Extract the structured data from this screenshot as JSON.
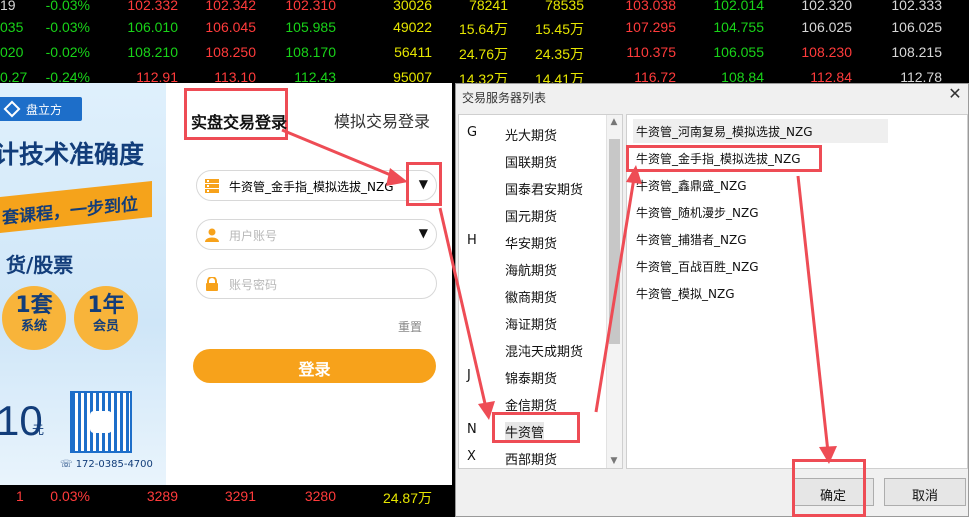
{
  "quotes": [
    {
      "c0": "19",
      "c1": "-0.03%",
      "c2": "102.332",
      "c3": "102.342",
      "c4": "102.310",
      "c5": "30026",
      "c6": "78241",
      "c7": "78535",
      "c8": "103.038",
      "c9": "102.014",
      "c10": "102.320",
      "c11": "102.333"
    },
    {
      "c0": "035",
      "c1": "-0.03%",
      "c2": "106.010",
      "c3": "106.045",
      "c4": "105.985",
      "c5": "49022",
      "c6": "15.64万",
      "c7": "15.45万",
      "c8": "107.295",
      "c9": "104.755",
      "c10": "106.025",
      "c11": "106.025"
    },
    {
      "c0": "020",
      "c1": "-0.02%",
      "c2": "108.210",
      "c3": "108.250",
      "c4": "108.170",
      "c5": "56411",
      "c6": "24.76万",
      "c7": "24.35万",
      "c8": "110.375",
      "c9": "106.055",
      "c10": "108.230",
      "c11": "108.215"
    },
    {
      "c0": "0.27",
      "c1": "-0.24%",
      "c2": "112.91",
      "c3": "113.10",
      "c4": "112.43",
      "c5": "95007",
      "c6": "14.32万",
      "c7": "14.41万",
      "c8": "116.72",
      "c9": "108.84",
      "c10": "112.84",
      "c11": "112.78"
    }
  ],
  "bottom_quote": {
    "c0": "1",
    "c1": "0.03%",
    "c2": "3289",
    "c3": "3291",
    "c4": "3280",
    "c5": "24.87万"
  },
  "promo": {
    "logo": "盘立方",
    "headline": "计技术准确度",
    "ribbon": "套课程，一步到位",
    "sub": "货/股票",
    "badge1_num": "1套",
    "badge1_text": "系统",
    "badge2_num": "1年",
    "badge2_text": "会员",
    "price": "10",
    "price_unit": "元",
    "phone": "172-0385-4700"
  },
  "login": {
    "tab_real": "实盘交易登录",
    "tab_sim": "模拟交易登录",
    "server_value": "牛资管_金手指_模拟选拔_NZG",
    "account_placeholder": "用户账号",
    "password_placeholder": "账号密码",
    "reset": "重置",
    "login_button": "登录"
  },
  "dialog": {
    "title": "交易服务器列表",
    "close": "✕",
    "brokers": [
      {
        "letter": "G",
        "name": "光大期货"
      },
      {
        "letter": "",
        "name": "国联期货"
      },
      {
        "letter": "",
        "name": "国泰君安期货"
      },
      {
        "letter": "",
        "name": "国元期货"
      },
      {
        "letter": "H",
        "name": "华安期货"
      },
      {
        "letter": "",
        "name": "海航期货"
      },
      {
        "letter": "",
        "name": "徽商期货"
      },
      {
        "letter": "",
        "name": "海证期货"
      },
      {
        "letter": "",
        "name": "混沌天成期货"
      },
      {
        "letter": "J",
        "name": "锦泰期货"
      },
      {
        "letter": "",
        "name": "金信期货"
      },
      {
        "letter": "N",
        "name": "牛资管"
      },
      {
        "letter": "X",
        "name": "西部期货"
      }
    ],
    "servers": [
      "牛资管_河南复易_模拟选拔_NZG",
      "牛资管_金手指_模拟选拔_NZG",
      "牛资管_鑫鼎盛_NZG",
      "牛资管_随机漫步_NZG",
      "牛资管_捕猎者_NZG",
      "牛资管_百战百胜_NZG",
      "牛资管_模拟_NZG"
    ],
    "ok": "确定",
    "cancel": "取消"
  },
  "colors": {
    "accent": "#f7a21b",
    "annotation": "#ee4c55",
    "up": "#ff3b3b",
    "down": "#19d319"
  }
}
